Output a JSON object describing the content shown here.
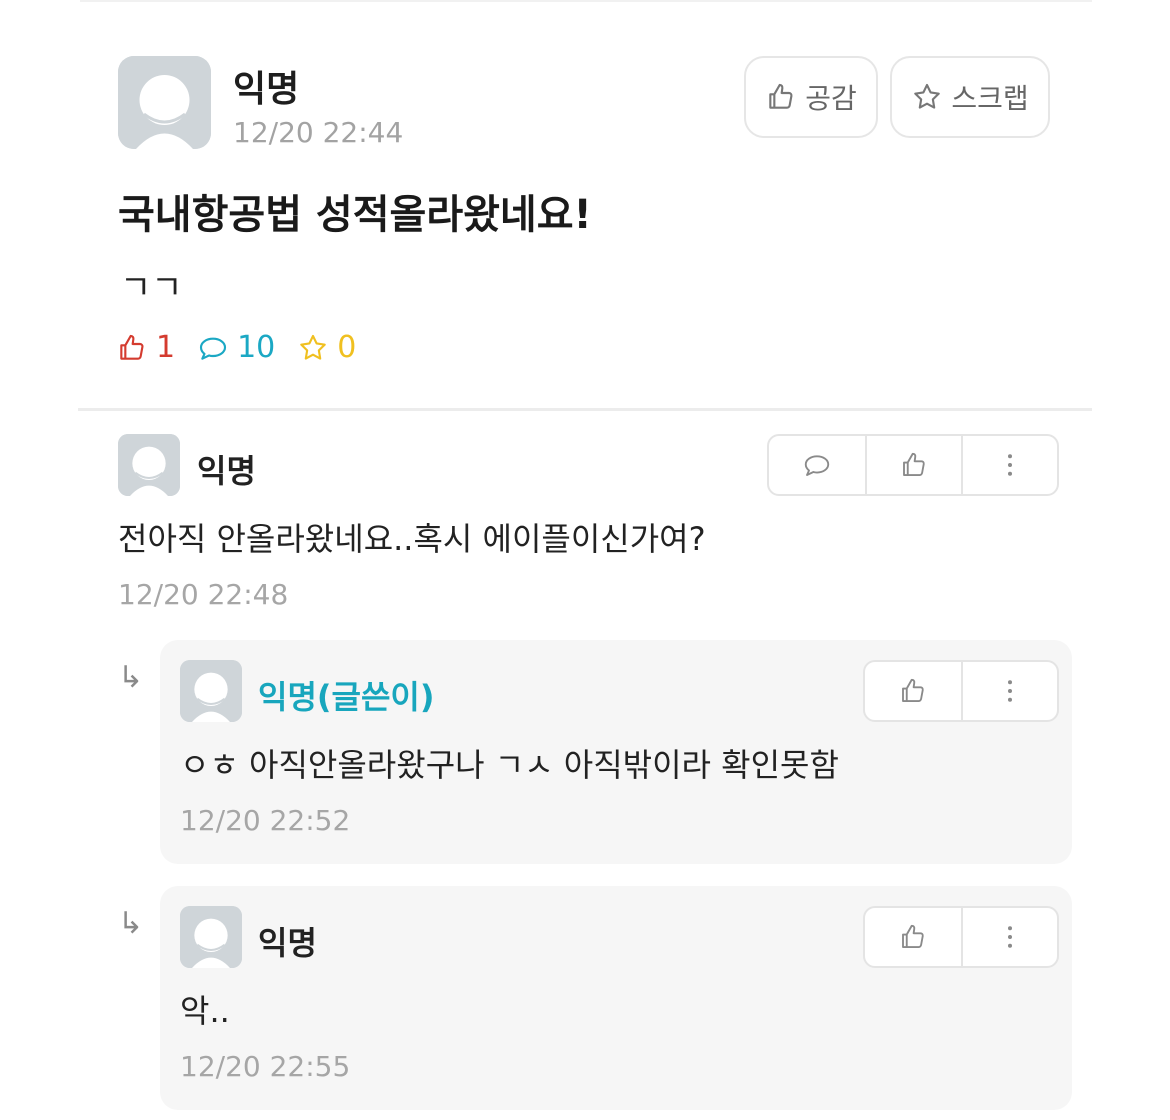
{
  "post": {
    "author": "익명",
    "time": "12/20 22:44",
    "like_button_label": "공감",
    "scrap_button_label": "스크랩",
    "title": "국내항공법 성적올라왔네요!",
    "body": "ㄱㄱ",
    "stats": {
      "likes": "1",
      "comments": "10",
      "scraps": "0"
    }
  },
  "colors": {
    "like": "#d43b2f",
    "comment": "#1ba8c4",
    "scrap": "#f0c020",
    "writer": "#18a6bd"
  },
  "comments": [
    {
      "author": "익명",
      "text": "전아직 안올라왔네요..혹시 에이플이신가여?",
      "time": "12/20 22:48",
      "replies": [
        {
          "author": "익명(글쓴이)",
          "text": "ㅇㅎ 아직안올라왔구나 ㄱㅅ 아직밖이라 확인못함",
          "time": "12/20 22:52"
        },
        {
          "author": "익명",
          "text": "악..",
          "time": "12/20 22:55"
        }
      ]
    }
  ],
  "icons": {
    "reply_arrow": "↳"
  }
}
